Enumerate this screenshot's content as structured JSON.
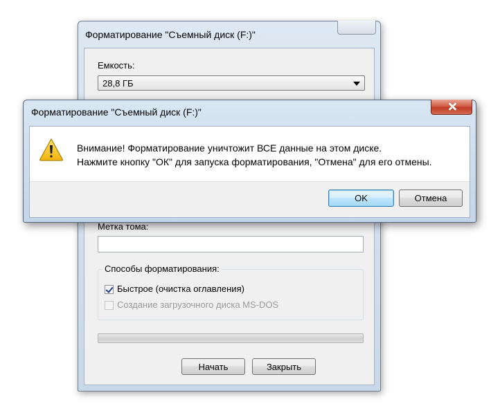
{
  "format_window": {
    "title": "Форматирование \"Съемный диск (F:)\"",
    "capacity_label": "Емкость:",
    "capacity_value": "28,8 ГБ",
    "volume_label_label": "Метка тома:",
    "volume_label_value": "",
    "format_options_title": "Способы форматирования:",
    "quick_format_label": "Быстрое (очистка оглавления)",
    "quick_format_checked": true,
    "msdos_boot_label": "Создание загрузочного диска MS-DOS",
    "msdos_boot_checked": false,
    "msdos_boot_enabled": false,
    "progress_fraction": 0,
    "start_button": "Начать",
    "close_button": "Закрыть"
  },
  "confirm_dialog": {
    "title": "Форматирование \"Съемный диск (F:)\"",
    "icon": "warning-icon",
    "message_line1": "Внимание! Форматирование уничтожит ВСЕ данные на этом диске.",
    "message_line2": "Нажмите кнопку \"ОК\" для запуска форматирования, \"Отмена\" для его отмены.",
    "ok_button": "OK",
    "cancel_button": "Отмена",
    "close_icon": "close-icon"
  },
  "colors": {
    "warning_yellow": "#f7c21a",
    "close_button_red": "#c13d24",
    "default_button_blue": "#3c7fb1"
  }
}
